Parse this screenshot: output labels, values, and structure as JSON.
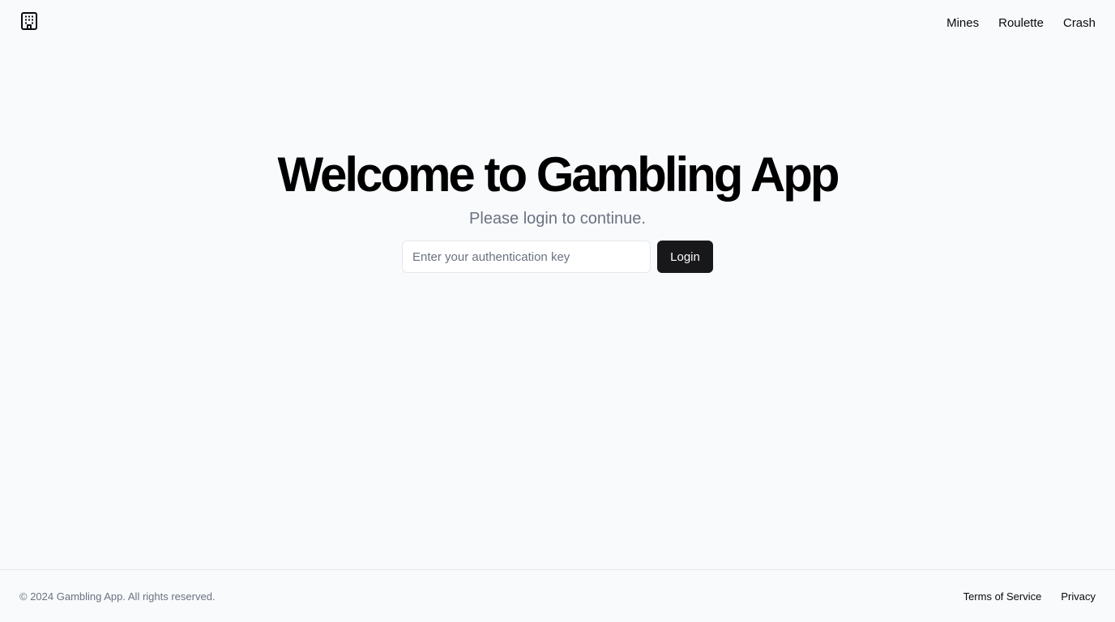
{
  "header": {
    "logo_icon": "building-icon",
    "nav": [
      {
        "label": "Mines"
      },
      {
        "label": "Roulette"
      },
      {
        "label": "Crash"
      }
    ]
  },
  "hero": {
    "title": "Welcome to Gambling App",
    "subtitle": "Please login to continue.",
    "auth_input": {
      "value": "",
      "placeholder": "Enter your authentication key"
    },
    "login_label": "Login"
  },
  "footer": {
    "copyright": "© 2024 Gambling App. All rights reserved.",
    "links": [
      {
        "label": "Terms of Service"
      },
      {
        "label": "Privacy"
      }
    ]
  },
  "colors": {
    "background": "#f8fafc",
    "primary_button": "#18181b",
    "muted_text": "#6b7280",
    "border": "#e5e7eb"
  }
}
